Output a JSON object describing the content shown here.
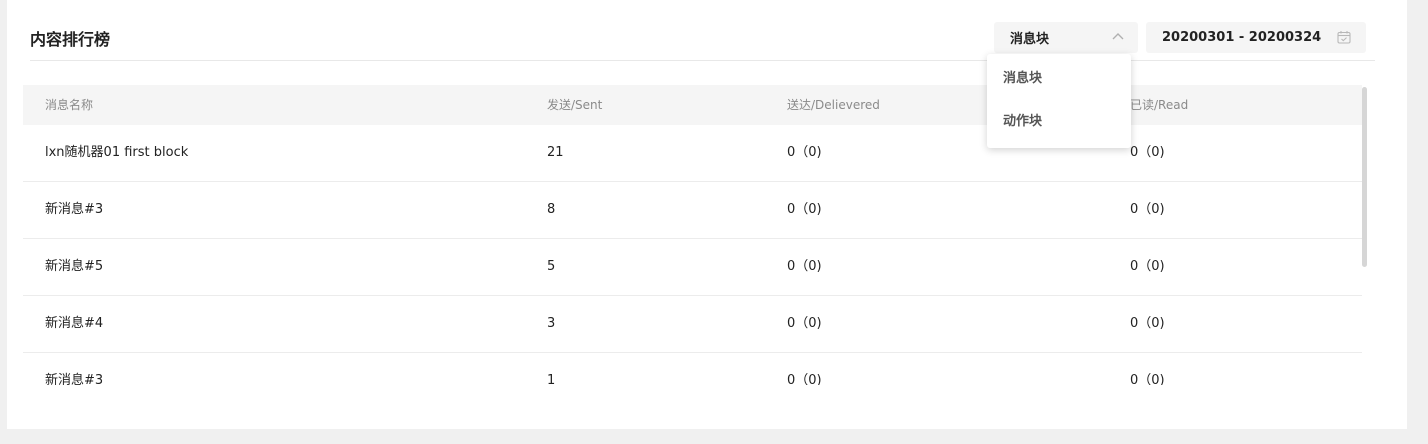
{
  "panel": {
    "title": "内容排行榜"
  },
  "filter": {
    "selected": "消息块",
    "options": [
      "消息块",
      "动作块"
    ],
    "date_range": "20200301 - 20200324"
  },
  "table": {
    "columns": [
      "消息名称",
      "发送/Sent",
      "送达/Delievered",
      "已读/Read"
    ],
    "rows": [
      [
        "lxn随机器01 first block",
        "21",
        "0（0)",
        "0（0)"
      ],
      [
        "新消息#3",
        "8",
        "0（0)",
        "0（0)"
      ],
      [
        "新消息#5",
        "5",
        "0（0)",
        "0（0)"
      ],
      [
        "新消息#4",
        "3",
        "0（0)",
        "0（0)"
      ],
      [
        "新消息#3",
        "1",
        "0（0)",
        "0（0)"
      ]
    ]
  },
  "icons": {
    "select_chevron": "chevron-up-icon",
    "calendar": "calendar-icon"
  }
}
